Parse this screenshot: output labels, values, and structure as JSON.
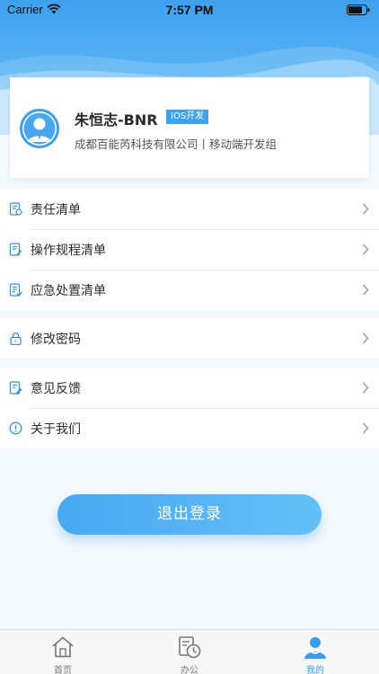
{
  "status_bar": {
    "carrier": "Carrier",
    "time": "7:57 PM"
  },
  "profile": {
    "name": "朱恒志-BNR",
    "badge": "IOS开发",
    "company": "成都百能芮科技有限公司丨移动端开发组"
  },
  "menu": {
    "group1": [
      {
        "label": "责任清单",
        "icon": "document-check-icon"
      },
      {
        "label": "操作规程清单",
        "icon": "document-edit-icon"
      },
      {
        "label": "应急处置清单",
        "icon": "document-list-icon"
      }
    ],
    "group2": [
      {
        "label": "修改密码",
        "icon": "lock-icon"
      }
    ],
    "group3": [
      {
        "label": "意见反馈",
        "icon": "feedback-icon"
      },
      {
        "label": "关于我们",
        "icon": "info-icon"
      }
    ]
  },
  "logout_label": "退出登录",
  "tabbar": [
    {
      "label": "首页",
      "icon": "home-icon",
      "active": false
    },
    {
      "label": "办公",
      "icon": "office-clock-icon",
      "active": false
    },
    {
      "label": "我的",
      "icon": "user-icon",
      "active": true
    }
  ],
  "colors": {
    "accent": "#3ea3ee",
    "header": "#57b3f4",
    "background": "#f4f9fd"
  }
}
